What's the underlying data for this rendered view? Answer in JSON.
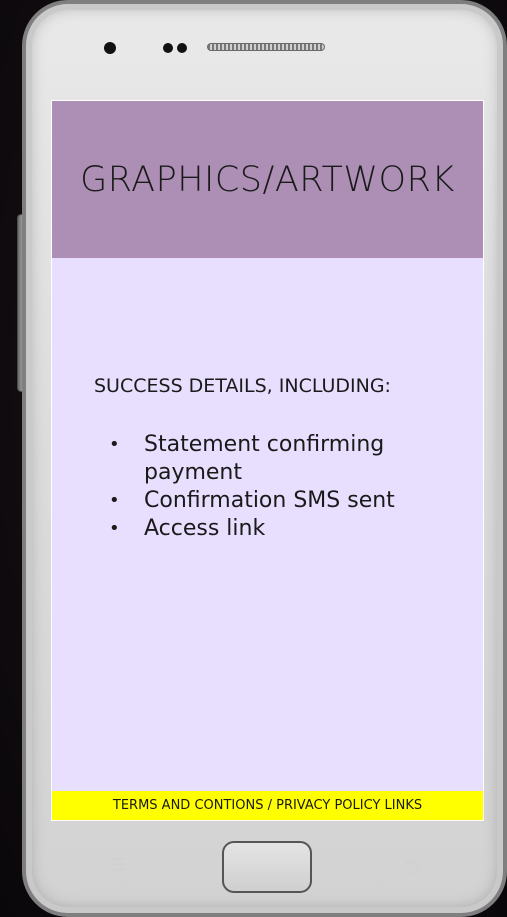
{
  "screen": {
    "title": "GRAPHICS/ARTWORK",
    "success_heading": "SUCCESS DETAILS, INCLUDING:",
    "bullets": [
      "Statement confirming payment",
      "Confirmation SMS sent",
      "Access link"
    ],
    "footer": "TERMS AND CONTIONS / PRIVACY POLICY LINKS"
  },
  "icons": {
    "menu": "menu-icon",
    "back": "back-arrow-icon",
    "home": "home-button"
  },
  "colors": {
    "header_bg": "#ad8fb5",
    "content_bg": "#e8defd",
    "footer_bg": "#ffff00",
    "phone_body": "#dcdcdc"
  }
}
